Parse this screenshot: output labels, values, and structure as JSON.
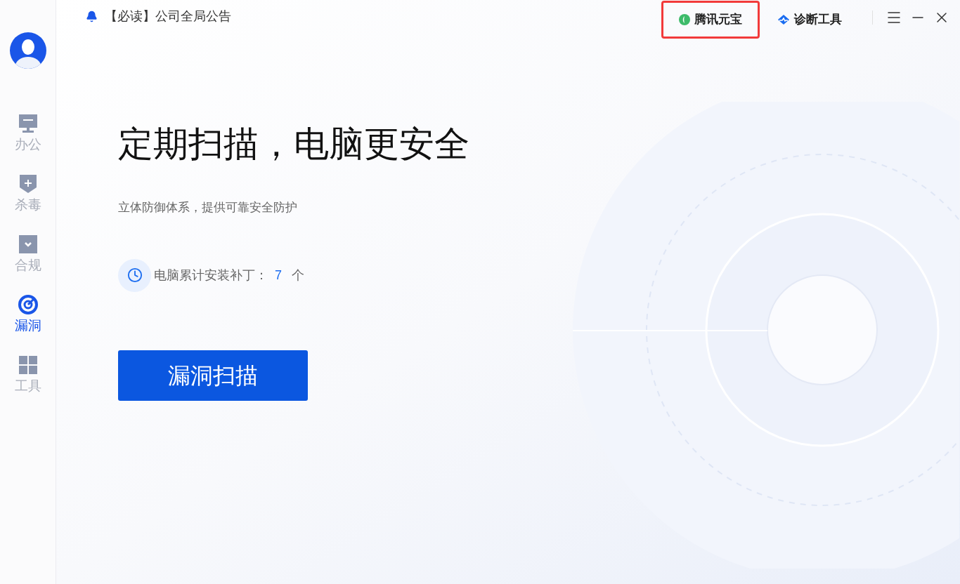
{
  "sidebar": {
    "items": [
      {
        "label": "办公",
        "selected": false
      },
      {
        "label": "杀毒",
        "selected": false
      },
      {
        "label": "合规",
        "selected": false
      },
      {
        "label": "漏洞",
        "selected": true
      },
      {
        "label": "工具",
        "selected": false
      }
    ]
  },
  "notice": {
    "text": "【必读】公司全局公告"
  },
  "toolbar": {
    "items": [
      {
        "label": "腾讯元宝",
        "highlighted": true
      },
      {
        "label": "诊断工具",
        "highlighted": false
      }
    ]
  },
  "hero": {
    "title": "定期扫描，电脑更安全",
    "subtitle": "立体防御体系，提供可靠安全防护",
    "stat": {
      "label": "电脑累计安装补丁：",
      "value": "7",
      "unit": "个"
    },
    "button": "漏洞扫描"
  }
}
